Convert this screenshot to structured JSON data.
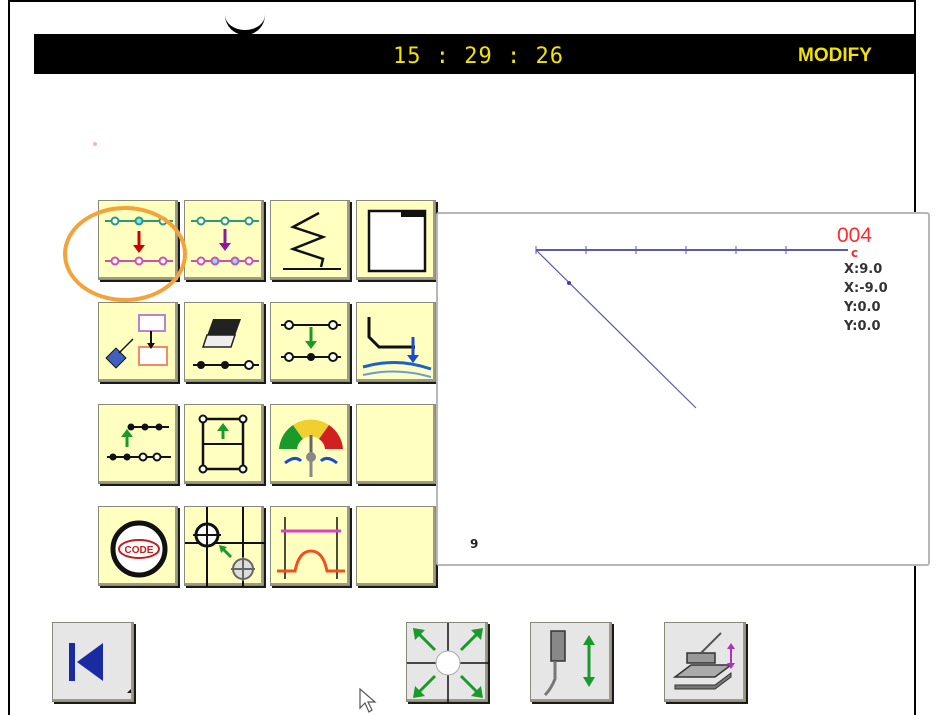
{
  "header": {
    "time": "15 : 29 : 26",
    "mode": "MODIFY"
  },
  "grid": {
    "rows": [
      [
        {
          "icon": "stitch-point-move-icon"
        },
        {
          "icon": "point-insert-move-icon"
        },
        {
          "icon": "zigzag-stitch-icon"
        },
        {
          "icon": "blank-page-icon"
        }
      ],
      [
        {
          "icon": "pattern-copy-icon"
        },
        {
          "icon": "eraser-delete-icon"
        },
        {
          "icon": "point-move-down-icon"
        },
        {
          "icon": "presser-foot-icon"
        }
      ],
      [
        {
          "icon": "section-move-icon"
        },
        {
          "icon": "frame-scale-icon"
        },
        {
          "icon": "speed-gauge-icon"
        },
        {
          "icon": "empty-slot"
        }
      ],
      [
        {
          "icon": "code-circle-icon"
        },
        {
          "icon": "crosshair-origin-icon"
        },
        {
          "icon": "thread-tension-icon"
        },
        {
          "icon": "empty-slot"
        }
      ]
    ]
  },
  "preview": {
    "pattern_id": "004",
    "marker": "c",
    "coords": [
      "X:9.0",
      "X:-9.0",
      "Y:0.0",
      "Y:0.0"
    ],
    "bottom_value": "9"
  },
  "bottom_bar": {
    "first_page": "first-page-icon",
    "jog": "jog-crosshair-icon",
    "needle": "needle-up-down-icon",
    "presser": "presser-lift-icon"
  },
  "colors": {
    "title_bg": "#000000",
    "title_text": "#f2e300",
    "button_bg": "#ffffc0",
    "highlight": "#f4a33a",
    "pattern_id": "#ff2a2a"
  }
}
